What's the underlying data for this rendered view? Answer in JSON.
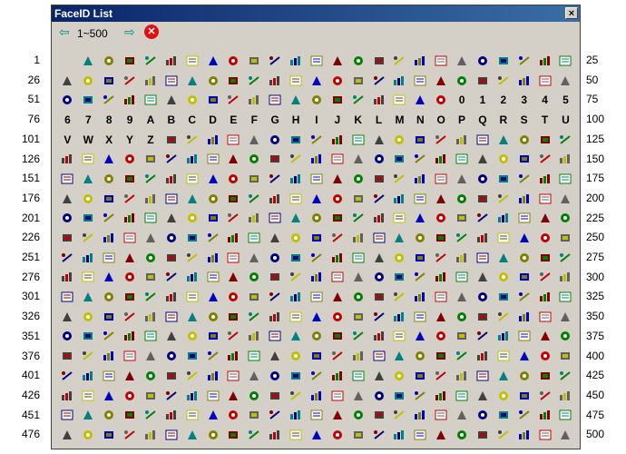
{
  "window": {
    "title": "FaceID List",
    "close_label": "×"
  },
  "nav": {
    "prev_icon": "arrow-left-icon",
    "range": "1~500",
    "next_icon": "arrow-right-icon",
    "stop_icon": "stop-icon"
  },
  "row_labels_left": [
    "1",
    "26",
    "51",
    "76",
    "101",
    "126",
    "151",
    "176",
    "201",
    "226",
    "251",
    "276",
    "301",
    "326",
    "351",
    "376",
    "401",
    "426",
    "451",
    "476"
  ],
  "row_labels_right": [
    "25",
    "50",
    "75",
    "100",
    "125",
    "150",
    "175",
    "200",
    "225",
    "250",
    "275",
    "300",
    "325",
    "350",
    "375",
    "400",
    "425",
    "450",
    "475",
    "500"
  ],
  "text_cells": {
    "row3": [
      "0",
      "1",
      "2",
      "3",
      "4",
      "5"
    ],
    "row4": [
      "6",
      "7",
      "8",
      "9",
      "A",
      "B",
      "C",
      "D",
      "E",
      "F",
      "G",
      "H",
      "I",
      "J",
      "K",
      "L",
      "M",
      "N",
      "O",
      "P",
      "Q",
      "R",
      "S",
      "T",
      "U"
    ],
    "row5": [
      "V",
      "W",
      "X",
      "Y",
      "Z"
    ]
  },
  "colors": {
    "title_bar": "#0a246a",
    "accent": "#0a8a8a",
    "stop": "#e01010"
  }
}
